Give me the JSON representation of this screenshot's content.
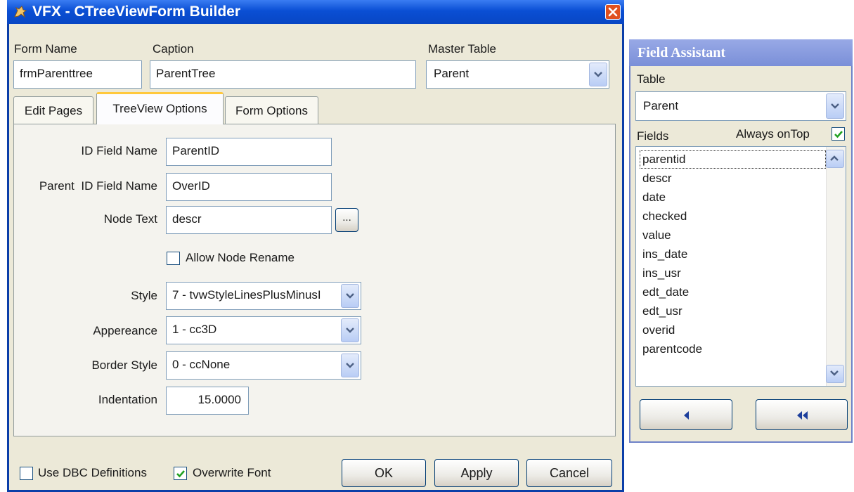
{
  "main_window": {
    "title": "VFX - CTreeViewForm Builder",
    "form_name": {
      "label": "Form Name",
      "value": "frmParenttree"
    },
    "caption": {
      "label": "Caption",
      "value": "ParentTree"
    },
    "master_table": {
      "label": "Master Table",
      "value": "Parent"
    },
    "tabs": [
      {
        "label": "Edit Pages",
        "active": false
      },
      {
        "label": "TreeView Options",
        "active": true
      },
      {
        "label": "Form Options",
        "active": false
      }
    ],
    "treeview_options": {
      "id_field_name": {
        "label": "ID Field Name",
        "value": "ParentID"
      },
      "parent_id_field_name": {
        "label": "Parent  ID Field Name",
        "value": "OverID"
      },
      "node_text": {
        "label": "Node Text",
        "value": "descr",
        "browse_label": "..."
      },
      "allow_node_rename": {
        "label": "Allow Node Rename",
        "checked": false
      },
      "style": {
        "label": "Style",
        "value": "7 - tvwStyleLinesPlusMinusI"
      },
      "appearance": {
        "label": "Appereance",
        "value": "1 - cc3D"
      },
      "border_style": {
        "label": "Border Style",
        "value": "0 - ccNone"
      },
      "indentation": {
        "label": "Indentation",
        "value": "15.0000"
      }
    },
    "footer": {
      "use_dbc_definitions": {
        "label": "Use DBC Definitions",
        "checked": false
      },
      "overwrite_font": {
        "label": "Overwrite Font",
        "checked": true
      },
      "ok_label": "OK",
      "apply_label": "Apply",
      "cancel_label": "Cancel"
    }
  },
  "field_assistant": {
    "title": "Field Assistant",
    "table_label": "Table",
    "table_value": "Parent",
    "fields_label": "Fields",
    "always_on_top": {
      "label": "Always onTop",
      "checked": true
    },
    "fields": [
      "parentid",
      "descr",
      "date",
      "checked",
      "value",
      "ins_date",
      "ins_usr",
      "edt_date",
      "edt_usr",
      "overid",
      "parentcode"
    ],
    "selected_field": "parentid"
  },
  "colors": {
    "title_bar": "#0a4fd4",
    "assistant_title_bar": "#7a8fd8",
    "window_face": "#ece9d8",
    "checkbox_check": "#21a121",
    "close_button": "#e0501e",
    "active_tab_accent": "#ffc83c"
  },
  "icons": {
    "app_icon": "horse-logo-icon",
    "close": "close-icon",
    "dropdown": "chevron-down-icon",
    "scroll_up": "scroll-up-icon",
    "scroll_down": "scroll-down-icon",
    "move_left": "triangle-left-icon",
    "move_all_left": "double-triangle-left-icon"
  }
}
